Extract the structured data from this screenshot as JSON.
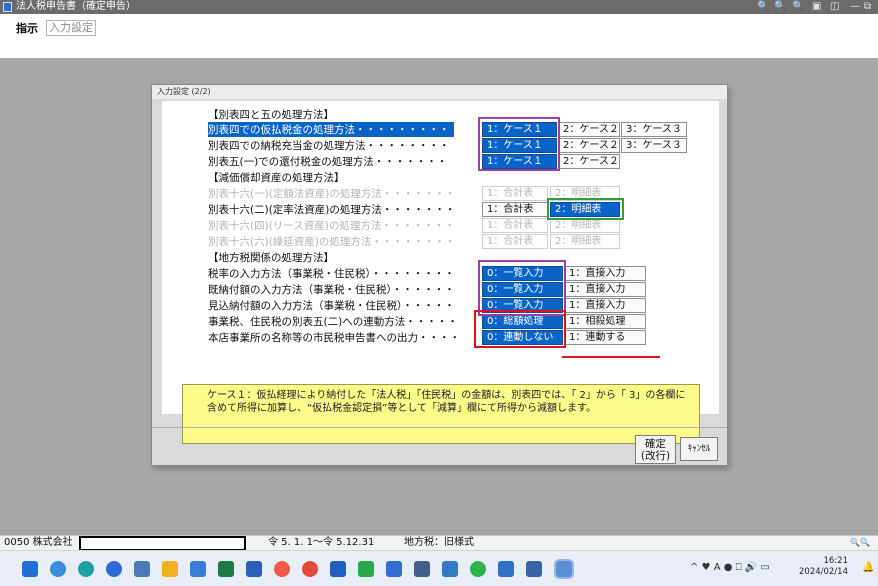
{
  "window": {
    "title": "法人税申告書（確定申告）",
    "controls": [
      "🔍",
      "🔍",
      "🔍",
      "▣",
      "◫",
      "—",
      "⧉"
    ]
  },
  "toolbar": {
    "selected": "指示",
    "other": "入力設定"
  },
  "dialog": {
    "title": "入力設定 (2/2)",
    "sections": {
      "s1": "【別表四と五の処理方法】",
      "s2": "【減価償却資産の処理方法】",
      "s3": "【地方税関係の処理方法】"
    },
    "rows": {
      "r1": "別表四での仮払税金の処理方法・・・・・・・・・",
      "r2": "別表四での納税充当金の処理方法・・・・・・・・",
      "r3": "別表五(一)での還付税金の処理方法・・・・・・・",
      "r4": "別表十六(一)(定額法資産)の処理方法・・・・・・・",
      "r5": "別表十六(二)(定率法資産)の処理方法・・・・・・・",
      "r6": "別表十六(四)(リース資産)の処理方法・・・・・・・",
      "r7": "別表十六(六)(繰延資産)の処理方法・・・・・・・・",
      "r8": "税率の入力方法（事業税・住民税）・・・・・・・・",
      "r9": "既納付額の入力方法（事業税・住民税）・・・・・・",
      "r10": "見込納付額の入力方法（事業税・住民税）・・・・・",
      "r11": "事業税、住民税の別表五(二)への連動方法・・・・・",
      "r12": "本店事業所の名称等の市民税申告書への出力・・・・"
    },
    "options": {
      "case1": "1：ケース１",
      "case2": "2：ケース２",
      "case3": "3：ケース３",
      "total": "1：合計表",
      "detail": "2：明細表",
      "list": "0：一覧入力",
      "direct": "1：直接入力",
      "gross": "0：総額処理",
      "offset": "1：相殺処理",
      "nolink": "0：連動しない",
      "link": "1：連動する"
    },
    "note": "ケース１：仮払経理により納付した「法人税」「住民税」の金額は、別表四では、「 2」から「 3」の各欄に含めて所得に加算し、“仮払税金認定損”等として「減算」欄にて所得から減額します。",
    "buttons": {
      "ok_line1": "確定",
      "ok_line2": "(改行)",
      "cancel": "ｷｬﾝｾﾙ"
    }
  },
  "statusbar": {
    "code": "0050 株式会社",
    "period": "令 5. 1. 1～令 5.12.31",
    "local_tax": "地方税：旧様式",
    "zoom": "🔍🔍"
  },
  "taskbar": {
    "time": "16:21",
    "date": "2024/02/14",
    "tray": "^ ♥ A ● ⎕ 🔊 ▭"
  },
  "colors": {
    "highlight_purple": "#9b3fa6",
    "highlight_green": "#2ea043",
    "highlight_red": "#e0131d",
    "active_option": "#0a64c8"
  }
}
